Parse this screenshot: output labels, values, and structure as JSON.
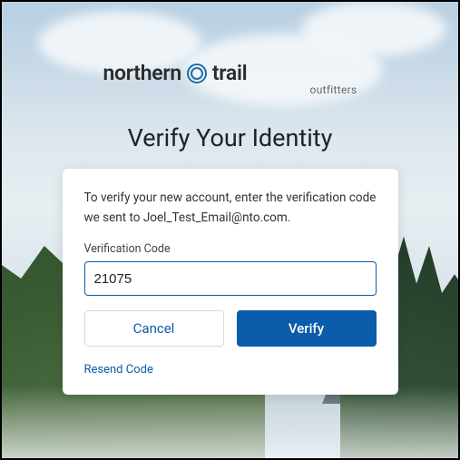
{
  "brand": {
    "word1": "northern",
    "word2": "trail",
    "tagline": "outfitters",
    "icon": "compass-icon"
  },
  "page": {
    "title": "Verify Your Identity"
  },
  "card": {
    "instruction_prefix": "To verify your new account, enter the verification code we sent to ",
    "email": "Joel_Test_Email@nto.com",
    "instruction_suffix": ".",
    "code_label": "Verification Code",
    "code_value": "21075",
    "cancel_label": "Cancel",
    "verify_label": "Verify",
    "resend_label": "Resend Code"
  },
  "colors": {
    "primary": "#0b5cab",
    "text": "#222222",
    "muted": "#666666"
  }
}
